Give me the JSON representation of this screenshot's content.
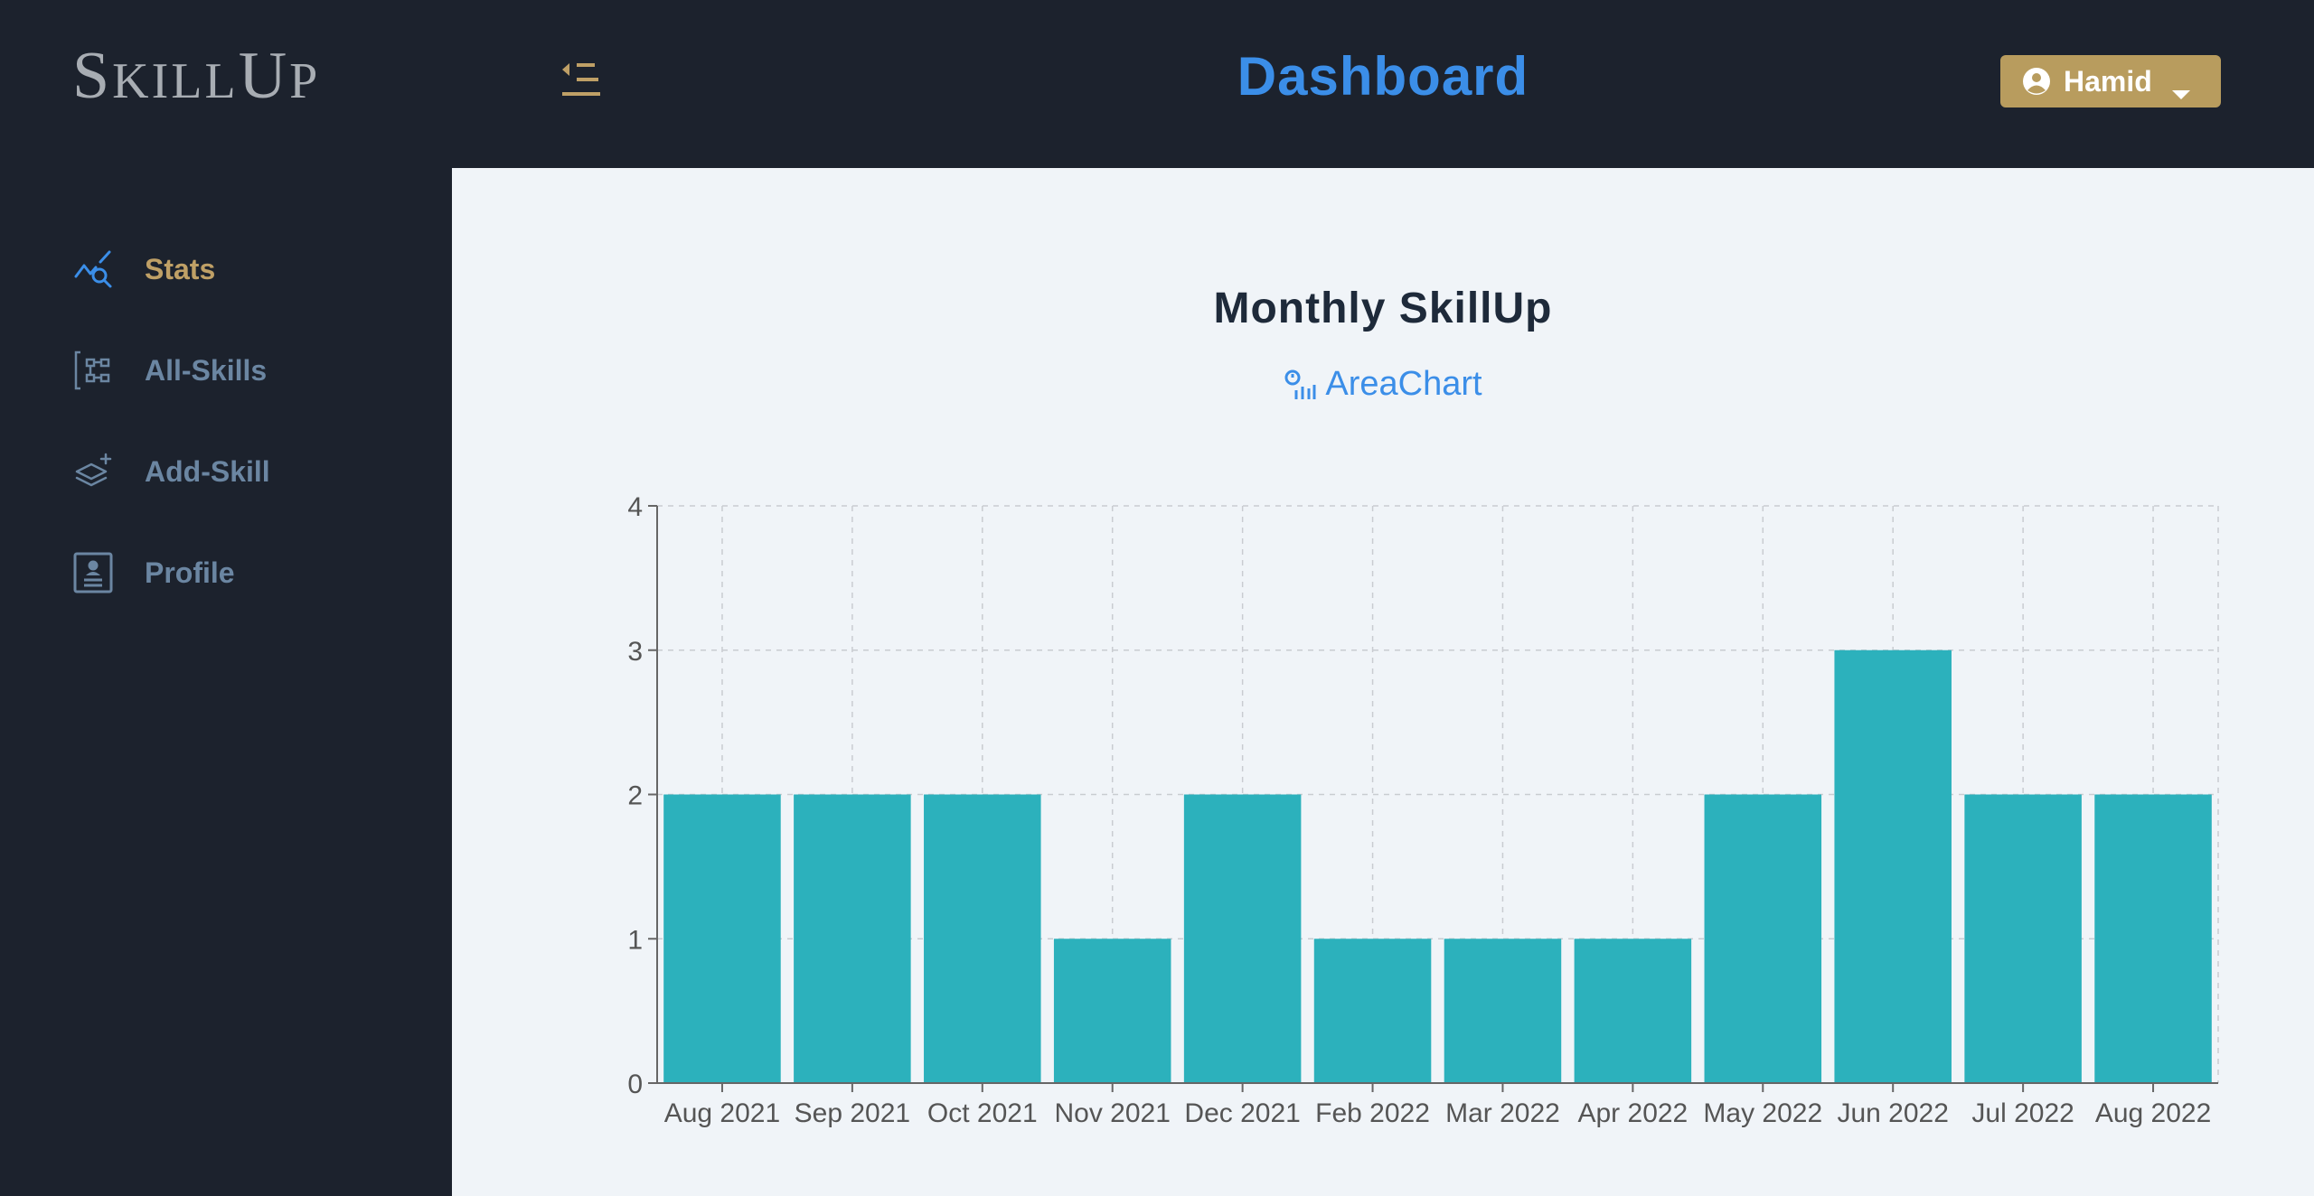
{
  "app": {
    "logo": "SkillUp"
  },
  "sidebar": {
    "items": [
      {
        "label": "Stats",
        "icon": "stats-icon",
        "active": true
      },
      {
        "label": "All-Skills",
        "icon": "skills-tree-icon",
        "active": false
      },
      {
        "label": "Add-Skill",
        "icon": "add-layers-icon",
        "active": false
      },
      {
        "label": "Profile",
        "icon": "profile-card-icon",
        "active": false
      }
    ]
  },
  "header": {
    "title": "Dashboard",
    "toggle_icon": "sidebar-toggle-icon",
    "user": {
      "name": "Hamid",
      "icon": "user-circle-icon",
      "caret_icon": "caret-down-icon"
    }
  },
  "main": {
    "chart_heading": "Monthly SkillUp",
    "chart_switch_label": "AreaChart"
  },
  "colors": {
    "background": "#1c222d",
    "main_bg": "#f0f4f8",
    "accent_gold": "#bfa066",
    "accent_blue": "#3b8ee8",
    "bar": "#2cb1bc",
    "nav_text": "#6b86a2"
  },
  "chart_data": {
    "type": "bar",
    "categories": [
      "Aug 2021",
      "Sep 2021",
      "Oct 2021",
      "Nov 2021",
      "Dec 2021",
      "Feb 2022",
      "Mar 2022",
      "Apr 2022",
      "May 2022",
      "Jun 2022",
      "Jul 2022",
      "Aug 2022"
    ],
    "values": [
      2,
      2,
      2,
      1,
      2,
      1,
      1,
      1,
      2,
      3,
      2,
      2
    ],
    "title": "Monthly SkillUp",
    "xlabel": "",
    "ylabel": "",
    "ylim": [
      0,
      4
    ],
    "yticks": [
      0,
      1,
      2,
      3,
      4
    ],
    "grid": true,
    "legend": "none"
  }
}
